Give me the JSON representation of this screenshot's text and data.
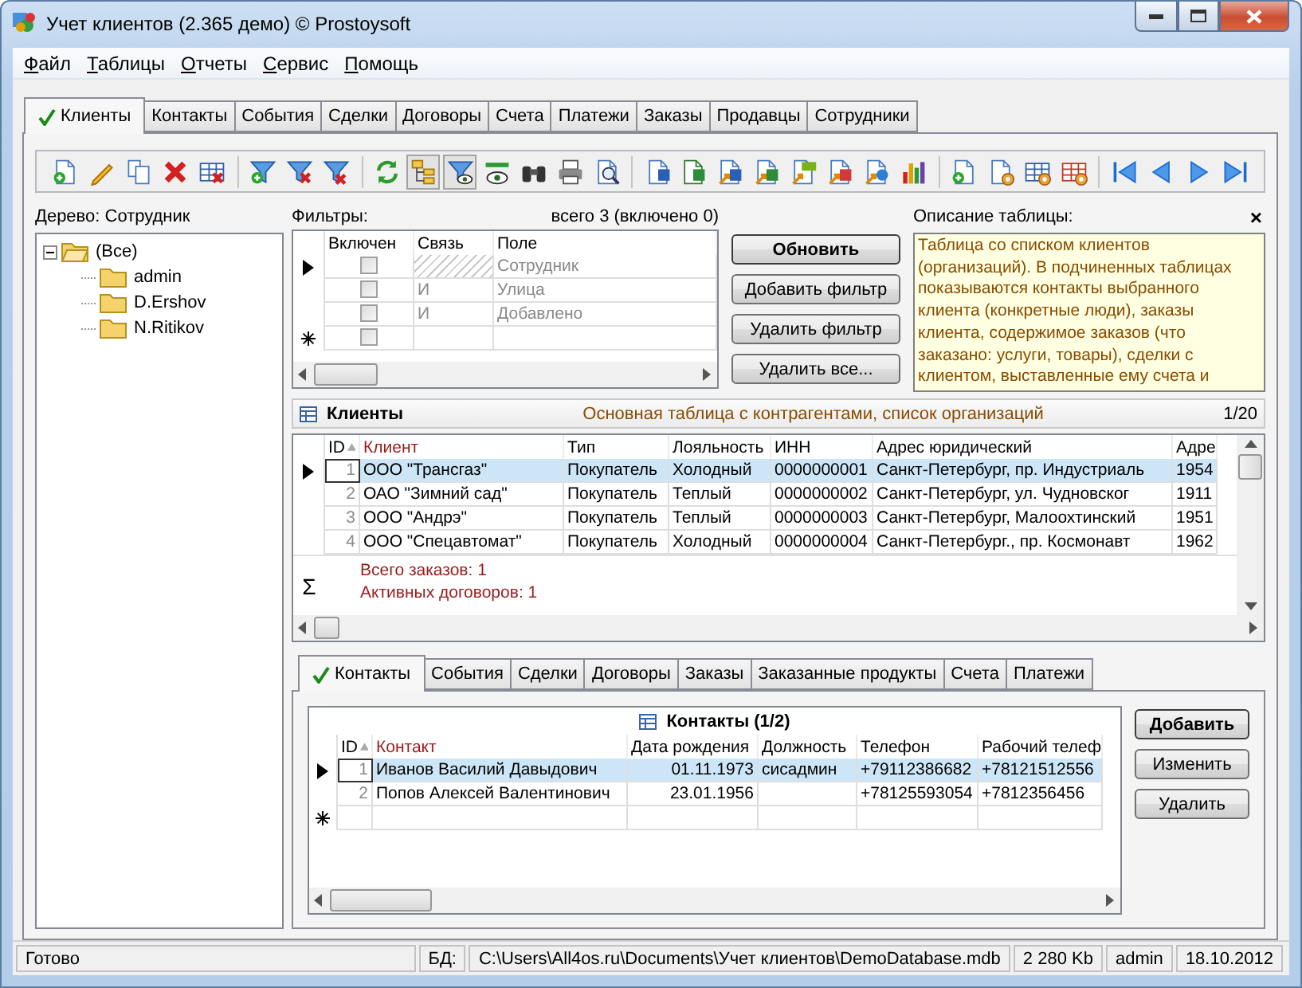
{
  "window": {
    "title": "Учет клиентов (2.365 демо) © Prostoysoft"
  },
  "menu": [
    "Файл",
    "Таблицы",
    "Отчеты",
    "Сервис",
    "Помощь"
  ],
  "tabs": [
    {
      "label": "Клиенты",
      "selected": true
    },
    {
      "label": "Контакты",
      "selected": false
    },
    {
      "label": "События",
      "selected": false
    },
    {
      "label": "Сделки",
      "selected": false
    },
    {
      "label": "Договоры",
      "selected": false
    },
    {
      "label": "Счета",
      "selected": false
    },
    {
      "label": "Платежи",
      "selected": false
    },
    {
      "label": "Заказы",
      "selected": false
    },
    {
      "label": "Продавцы",
      "selected": false
    },
    {
      "label": "Сотрудники",
      "selected": false
    }
  ],
  "toolbar": [
    {
      "pressed": false
    },
    {
      "pressed": false
    },
    {
      "pressed": false
    },
    {
      "pressed": false
    },
    {
      "pressed": false
    },
    {
      "pressed": false
    },
    {
      "pressed": false
    },
    {
      "pressed": false
    },
    {
      "pressed": false
    },
    {
      "pressed": true
    },
    {
      "pressed": true
    },
    {
      "pressed": false
    },
    {
      "pressed": false
    },
    {
      "pressed": false
    },
    {
      "pressed": false
    },
    {
      "pressed": false
    },
    {
      "pressed": false
    },
    {
      "pressed": false
    },
    {
      "pressed": false
    },
    {
      "pressed": false
    },
    {
      "pressed": false
    },
    {
      "pressed": false
    },
    {
      "pressed": false
    },
    {
      "pressed": false
    },
    {
      "pressed": false
    },
    {
      "pressed": false
    },
    {
      "pressed": false
    },
    {
      "pressed": false
    },
    {
      "pressed": false
    },
    {
      "pressed": false
    },
    {
      "pressed": false
    }
  ],
  "tree": {
    "title": "Дерево: Сотрудник",
    "items": [
      {
        "label": "(Все)",
        "expanded": true,
        "children": [
          {
            "label": "admin"
          },
          {
            "label": "D.Ershov"
          },
          {
            "label": "N.Ritikov"
          }
        ]
      }
    ]
  },
  "filters": {
    "title": "Фильтры:",
    "summary": "всего 3 (включено 0)",
    "columns": [
      "Включен",
      "Связь",
      "Поле"
    ],
    "rows": [
      {
        "current": true,
        "enabled": false,
        "field": "Сотрудник"
      },
      {
        "current": false,
        "enabled": false,
        "link": "И",
        "field": "Улица"
      },
      {
        "current": false,
        "enabled": false,
        "link": "И",
        "field": "Добавлено"
      }
    ],
    "new_row": {
      "enabled": false
    },
    "buttons": [
      {
        "label": "Обновить",
        "default": true
      },
      {
        "label": "Добавить фильтр",
        "default": false
      },
      {
        "label": "Удалить фильтр",
        "default": false
      },
      {
        "label": "Удалить все...",
        "default": false
      }
    ]
  },
  "description": {
    "title": "Описание таблицы:",
    "close": "×",
    "text": "Таблица со списком клиентов\n(организаций). В подчиненных таблицах\nпоказываются контакты выбранного\nклиента (конкретные люди), заказы\nклиента, содержимое заказов (что\nзаказано: услуги, товары), сделки с\nклиентом, выставленные ему счета и"
  },
  "clients": {
    "title": "Клиенты",
    "subtitle": "Основная таблица с контрагентами, список организаций",
    "position": "1/20",
    "columns": [
      {
        "label": "ID",
        "sorted": true,
        "key": false
      },
      {
        "label": "Клиент",
        "sorted": false,
        "key": true
      },
      {
        "label": "Тип",
        "sorted": false,
        "key": false
      },
      {
        "label": "Лояльность",
        "sorted": false,
        "key": false
      },
      {
        "label": "ИНН",
        "sorted": false,
        "key": false
      },
      {
        "label": "Адрес юридический",
        "sorted": false,
        "key": false
      },
      {
        "label": "Адре",
        "sorted": false,
        "key": false
      }
    ],
    "rows": [
      {
        "selected": true,
        "cells": [
          "1",
          "ООО \"Трансгаз\"",
          "Покупатель",
          "Холодный",
          "0000000001",
          "Санкт-Петербург, пр. Индустриаль",
          "1954"
        ]
      },
      {
        "selected": false,
        "cells": [
          "2",
          "ОАО \"Зимний сад\"",
          "Покупатель",
          "Теплый",
          "0000000002",
          "Санкт-Петербург, ул. Чудновског",
          "1911"
        ]
      },
      {
        "selected": false,
        "cells": [
          "3",
          "ООО \"Андрэ\"",
          "Покупатель",
          "Теплый",
          "0000000003",
          "Санкт-Петербург, Малоохтинский",
          "1951"
        ]
      },
      {
        "selected": false,
        "cells": [
          "4",
          "ООО \"Спецавтомат\"",
          "Покупатель",
          "Холодный",
          "0000000004",
          "Санкт-Петербург., пр. Космонавт",
          "1962"
        ]
      }
    ],
    "summary_symbol": "Σ",
    "summary": [
      "Всего заказов: 1",
      "Активных договоров: 1"
    ]
  },
  "detail_tabs": [
    {
      "label": "Контакты",
      "selected": true
    },
    {
      "label": "События",
      "selected": false
    },
    {
      "label": "Сделки",
      "selected": false
    },
    {
      "label": "Договоры",
      "selected": false
    },
    {
      "label": "Заказы",
      "selected": false
    },
    {
      "label": "Заказанные продукты",
      "selected": false
    },
    {
      "label": "Счета",
      "selected": false
    },
    {
      "label": "Платежи",
      "selected": false
    }
  ],
  "contacts": {
    "title": "Контакты (1/2)",
    "columns": [
      {
        "label": "ID",
        "sorted": true,
        "key": false
      },
      {
        "label": "Контакт",
        "sorted": false,
        "key": true
      },
      {
        "label": "Дата рождения",
        "sorted": false,
        "key": false
      },
      {
        "label": "Должность",
        "sorted": false,
        "key": false
      },
      {
        "label": "Телефон",
        "sorted": false,
        "key": false
      },
      {
        "label": "Рабочий телеф",
        "sorted": false,
        "key": false
      }
    ],
    "rows": [
      {
        "selected": true,
        "cells": [
          "1",
          "Иванов Василий Давыдович",
          "01.11.1973",
          "сисадмин",
          "+79112386682",
          "+78121512556"
        ]
      },
      {
        "selected": false,
        "cells": [
          "2",
          "Попов Алексей Валентинович",
          "23.01.1956",
          null,
          "+78125593054",
          "+7812356456"
        ]
      }
    ],
    "new_row": true,
    "buttons": [
      {
        "label": "Добавить",
        "default": true
      },
      {
        "label": "Изменить",
        "default": false
      },
      {
        "label": "Удалить",
        "default": false
      }
    ]
  },
  "status_bar": [
    "Готово",
    "БД:",
    "C:\\Users\\All4os.ru\\Documents\\Учет клиентов\\DemoDatabase.mdb",
    "2 280 Kb",
    "admin",
    "18.10.2012"
  ]
}
